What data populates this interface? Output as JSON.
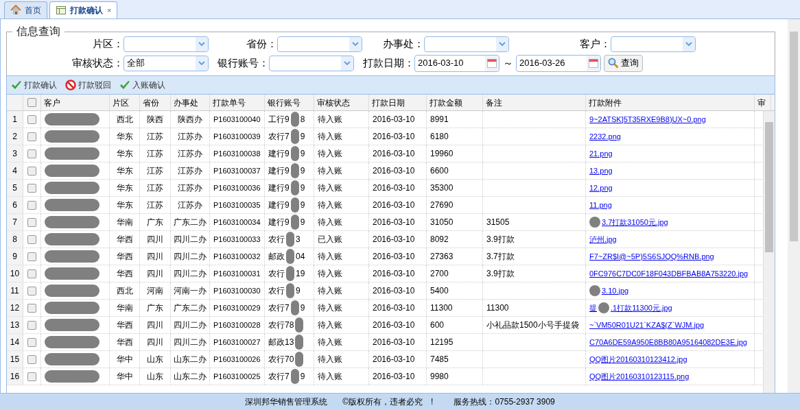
{
  "tabs": [
    {
      "label": "首页",
      "selected": false
    },
    {
      "label": "打款确认",
      "selected": true,
      "closable": true
    }
  ],
  "close_glyph": "×",
  "query": {
    "title": "信息查询",
    "row1": [
      {
        "label": "片区："
      },
      {
        "label": "省份："
      },
      {
        "label": "办事处："
      },
      {
        "label": "客户："
      }
    ],
    "row2": {
      "status": {
        "label": "审核状态：",
        "value": "全部"
      },
      "bank": {
        "label": "银行账号："
      },
      "date": {
        "label": "打款日期：",
        "from": "2016-03-10",
        "separator": "～",
        "to": "2016-03-26"
      },
      "search_button": "查询"
    }
  },
  "toolbar": [
    {
      "label": "打款确认",
      "kind": "confirm"
    },
    {
      "label": "打款驳回",
      "kind": "reject"
    },
    {
      "label": "入账确认",
      "kind": "confirm"
    }
  ],
  "table": {
    "all_checked": false,
    "columns": [
      "客户",
      "片区",
      "省份",
      "办事处",
      "打款单号",
      "银行账号",
      "审核状态",
      "打款日期",
      "打款金额",
      "备注",
      "打款附件",
      "审"
    ],
    "rows": [
      {
        "n": "1",
        "checked": false,
        "region": "西北",
        "province": "陕西",
        "office": "陕西办",
        "order": "P1603100040",
        "bank": {
          "prefix": "工行9",
          "suffix": "8"
        },
        "status": "待入账",
        "date": "2016-03-10",
        "amount": "8991",
        "attachment": {
          "text": "9~2ATSK]5T35RXE9B8)UX~0.png"
        }
      },
      {
        "n": "2",
        "checked": false,
        "region": "华东",
        "province": "江苏",
        "office": "江苏办",
        "order": "P1603100039",
        "bank": {
          "prefix": "农行7",
          "suffix": "9"
        },
        "status": "待入账",
        "date": "2016-03-10",
        "amount": "6180",
        "attachment": {
          "text": "2232.png"
        }
      },
      {
        "n": "3",
        "checked": false,
        "region": "华东",
        "province": "江苏",
        "office": "江苏办",
        "order": "P1603100038",
        "bank": {
          "prefix": "建行9",
          "suffix": "9"
        },
        "status": "待入账",
        "date": "2016-03-10",
        "amount": "19960",
        "attachment": {
          "text": "21.png"
        }
      },
      {
        "n": "4",
        "checked": false,
        "region": "华东",
        "province": "江苏",
        "office": "江苏办",
        "order": "P1603100037",
        "bank": {
          "prefix": "建行9",
          "suffix": "9"
        },
        "status": "待入账",
        "date": "2016-03-10",
        "amount": "6600",
        "attachment": {
          "text": "13.png"
        }
      },
      {
        "n": "5",
        "checked": false,
        "region": "华东",
        "province": "江苏",
        "office": "江苏办",
        "order": "P1603100036",
        "bank": {
          "prefix": "建行9",
          "suffix": "9"
        },
        "status": "待入账",
        "date": "2016-03-10",
        "amount": "35300",
        "attachment": {
          "text": "12.png"
        }
      },
      {
        "n": "6",
        "checked": false,
        "region": "华东",
        "province": "江苏",
        "office": "江苏办",
        "order": "P1603100035",
        "bank": {
          "prefix": "建行9",
          "suffix": "9"
        },
        "status": "待入账",
        "date": "2016-03-10",
        "amount": "27690",
        "attachment": {
          "text": "11.png"
        }
      },
      {
        "n": "7",
        "checked": false,
        "region": "华南",
        "province": "广东",
        "office": "广东二办",
        "order": "P1603100034",
        "bank": {
          "prefix": "建行9",
          "suffix": "9"
        },
        "status": "待入账",
        "date": "2016-03-10",
        "amount": "31050",
        "note": "31505",
        "attachment": {
          "text": "3.7打款31050元.jpg",
          "redacted": true
        }
      },
      {
        "n": "8",
        "checked": false,
        "region": "华西",
        "province": "四川",
        "office": "四川二办",
        "order": "P1603100033",
        "bank": {
          "prefix": "农行",
          "suffix": "3"
        },
        "status": "已入账",
        "date": "2016-03-10",
        "amount": "8092",
        "note": "3.9打款",
        "attachment": {
          "text": "泸州.jpg"
        }
      },
      {
        "n": "9",
        "checked": false,
        "region": "华西",
        "province": "四川",
        "office": "四川二办",
        "order": "P1603100032",
        "bank": {
          "prefix": "邮政",
          "suffix": "04"
        },
        "status": "待入账",
        "date": "2016-03-10",
        "amount": "27363",
        "note": "3.7打款",
        "attachment": {
          "text": "F7~ZR$I@~5P)5S6SJQQ%RNB.png"
        }
      },
      {
        "n": "10",
        "checked": false,
        "region": "华西",
        "province": "四川",
        "office": "四川二办",
        "order": "P1603100031",
        "bank": {
          "prefix": "农行",
          "suffix": "19"
        },
        "status": "待入账",
        "date": "2016-03-10",
        "amount": "2700",
        "note": "3.9打款",
        "attachment": {
          "text": "0FC976C7DC0F18F043DBFBAB8A753220.jpg"
        }
      },
      {
        "n": "11",
        "checked": false,
        "region": "西北",
        "province": "河南",
        "office": "河南一办",
        "order": "P1603100030",
        "bank": {
          "prefix": "农行",
          "suffix": "9"
        },
        "status": "待入账",
        "date": "2016-03-10",
        "amount": "5400",
        "attachment": {
          "text": "3.10.jpg",
          "redacted": true
        }
      },
      {
        "n": "12",
        "checked": false,
        "region": "华南",
        "province": "广东",
        "office": "广东二办",
        "order": "P1603100029",
        "bank": {
          "prefix": "农行7",
          "suffix": "9"
        },
        "status": "待入账",
        "date": "2016-03-10",
        "amount": "11300",
        "note": "11300",
        "attachment": {
          "prefix": "提",
          "text": ".1打款11300元.jpg",
          "redacted": true
        }
      },
      {
        "n": "13",
        "checked": false,
        "region": "华西",
        "province": "四川",
        "office": "四川二办",
        "order": "P1603100028",
        "bank": {
          "prefix": "农行78"
        },
        "status": "待入账",
        "date": "2016-03-10",
        "amount": "600",
        "note": "小礼品款1500小号手提袋",
        "attachment": {
          "text": "~`VM50R01U21`KZA$(Z`WJM.jpg"
        }
      },
      {
        "n": "14",
        "checked": false,
        "region": "华西",
        "province": "四川",
        "office": "四川二办",
        "order": "P1603100027",
        "bank": {
          "prefix": "邮政13"
        },
        "status": "待入账",
        "date": "2016-03-10",
        "amount": "12195",
        "attachment": {
          "text": "C70A6DE59A950E8BB80A95164082DE3E.jpg"
        }
      },
      {
        "n": "15",
        "checked": false,
        "region": "华中",
        "province": "山东",
        "office": "山东二办",
        "order": "P1603100026",
        "bank": {
          "prefix": "农行70"
        },
        "status": "待入账",
        "date": "2016-03-10",
        "amount": "7485",
        "attachment": {
          "text": "QQ图片20160310123412.jpg"
        }
      },
      {
        "n": "16",
        "checked": false,
        "region": "华中",
        "province": "山东",
        "office": "山东二办",
        "order": "P1603100025",
        "bank": {
          "prefix": "农行7",
          "suffix": "9"
        },
        "status": "待入账",
        "date": "2016-03-10",
        "amount": "9980",
        "attachment": {
          "text": "QQ图片20160310123115.png"
        }
      }
    ]
  },
  "status_bar": {
    "system": "深圳邦华销售管理系统",
    "copyright": "©版权所有，违者必究　!",
    "hotline": "服务热线：0755-2937 3909"
  }
}
